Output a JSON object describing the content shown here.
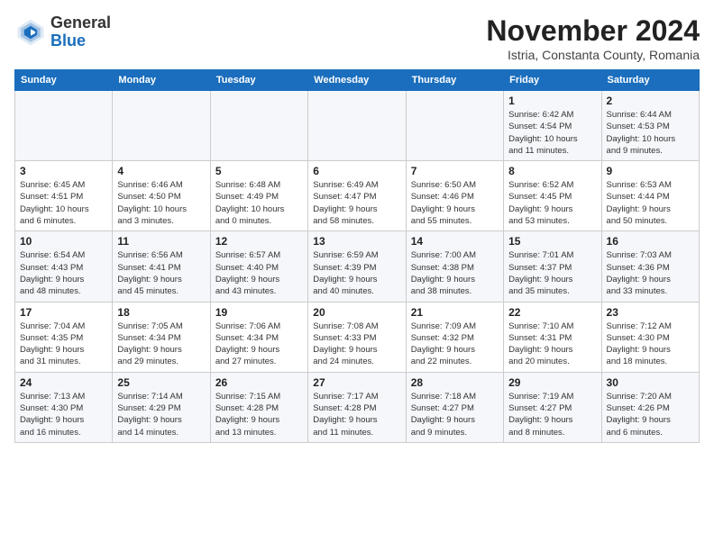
{
  "header": {
    "logo_line1": "General",
    "logo_line2": "Blue",
    "month": "November 2024",
    "location": "Istria, Constanta County, Romania"
  },
  "days_of_week": [
    "Sunday",
    "Monday",
    "Tuesday",
    "Wednesday",
    "Thursday",
    "Friday",
    "Saturday"
  ],
  "weeks": [
    [
      {
        "num": "",
        "info": ""
      },
      {
        "num": "",
        "info": ""
      },
      {
        "num": "",
        "info": ""
      },
      {
        "num": "",
        "info": ""
      },
      {
        "num": "",
        "info": ""
      },
      {
        "num": "1",
        "info": "Sunrise: 6:42 AM\nSunset: 4:54 PM\nDaylight: 10 hours\nand 11 minutes."
      },
      {
        "num": "2",
        "info": "Sunrise: 6:44 AM\nSunset: 4:53 PM\nDaylight: 10 hours\nand 9 minutes."
      }
    ],
    [
      {
        "num": "3",
        "info": "Sunrise: 6:45 AM\nSunset: 4:51 PM\nDaylight: 10 hours\nand 6 minutes."
      },
      {
        "num": "4",
        "info": "Sunrise: 6:46 AM\nSunset: 4:50 PM\nDaylight: 10 hours\nand 3 minutes."
      },
      {
        "num": "5",
        "info": "Sunrise: 6:48 AM\nSunset: 4:49 PM\nDaylight: 10 hours\nand 0 minutes."
      },
      {
        "num": "6",
        "info": "Sunrise: 6:49 AM\nSunset: 4:47 PM\nDaylight: 9 hours\nand 58 minutes."
      },
      {
        "num": "7",
        "info": "Sunrise: 6:50 AM\nSunset: 4:46 PM\nDaylight: 9 hours\nand 55 minutes."
      },
      {
        "num": "8",
        "info": "Sunrise: 6:52 AM\nSunset: 4:45 PM\nDaylight: 9 hours\nand 53 minutes."
      },
      {
        "num": "9",
        "info": "Sunrise: 6:53 AM\nSunset: 4:44 PM\nDaylight: 9 hours\nand 50 minutes."
      }
    ],
    [
      {
        "num": "10",
        "info": "Sunrise: 6:54 AM\nSunset: 4:43 PM\nDaylight: 9 hours\nand 48 minutes."
      },
      {
        "num": "11",
        "info": "Sunrise: 6:56 AM\nSunset: 4:41 PM\nDaylight: 9 hours\nand 45 minutes."
      },
      {
        "num": "12",
        "info": "Sunrise: 6:57 AM\nSunset: 4:40 PM\nDaylight: 9 hours\nand 43 minutes."
      },
      {
        "num": "13",
        "info": "Sunrise: 6:59 AM\nSunset: 4:39 PM\nDaylight: 9 hours\nand 40 minutes."
      },
      {
        "num": "14",
        "info": "Sunrise: 7:00 AM\nSunset: 4:38 PM\nDaylight: 9 hours\nand 38 minutes."
      },
      {
        "num": "15",
        "info": "Sunrise: 7:01 AM\nSunset: 4:37 PM\nDaylight: 9 hours\nand 35 minutes."
      },
      {
        "num": "16",
        "info": "Sunrise: 7:03 AM\nSunset: 4:36 PM\nDaylight: 9 hours\nand 33 minutes."
      }
    ],
    [
      {
        "num": "17",
        "info": "Sunrise: 7:04 AM\nSunset: 4:35 PM\nDaylight: 9 hours\nand 31 minutes."
      },
      {
        "num": "18",
        "info": "Sunrise: 7:05 AM\nSunset: 4:34 PM\nDaylight: 9 hours\nand 29 minutes."
      },
      {
        "num": "19",
        "info": "Sunrise: 7:06 AM\nSunset: 4:34 PM\nDaylight: 9 hours\nand 27 minutes."
      },
      {
        "num": "20",
        "info": "Sunrise: 7:08 AM\nSunset: 4:33 PM\nDaylight: 9 hours\nand 24 minutes."
      },
      {
        "num": "21",
        "info": "Sunrise: 7:09 AM\nSunset: 4:32 PM\nDaylight: 9 hours\nand 22 minutes."
      },
      {
        "num": "22",
        "info": "Sunrise: 7:10 AM\nSunset: 4:31 PM\nDaylight: 9 hours\nand 20 minutes."
      },
      {
        "num": "23",
        "info": "Sunrise: 7:12 AM\nSunset: 4:30 PM\nDaylight: 9 hours\nand 18 minutes."
      }
    ],
    [
      {
        "num": "24",
        "info": "Sunrise: 7:13 AM\nSunset: 4:30 PM\nDaylight: 9 hours\nand 16 minutes."
      },
      {
        "num": "25",
        "info": "Sunrise: 7:14 AM\nSunset: 4:29 PM\nDaylight: 9 hours\nand 14 minutes."
      },
      {
        "num": "26",
        "info": "Sunrise: 7:15 AM\nSunset: 4:28 PM\nDaylight: 9 hours\nand 13 minutes."
      },
      {
        "num": "27",
        "info": "Sunrise: 7:17 AM\nSunset: 4:28 PM\nDaylight: 9 hours\nand 11 minutes."
      },
      {
        "num": "28",
        "info": "Sunrise: 7:18 AM\nSunset: 4:27 PM\nDaylight: 9 hours\nand 9 minutes."
      },
      {
        "num": "29",
        "info": "Sunrise: 7:19 AM\nSunset: 4:27 PM\nDaylight: 9 hours\nand 8 minutes."
      },
      {
        "num": "30",
        "info": "Sunrise: 7:20 AM\nSunset: 4:26 PM\nDaylight: 9 hours\nand 6 minutes."
      }
    ]
  ]
}
